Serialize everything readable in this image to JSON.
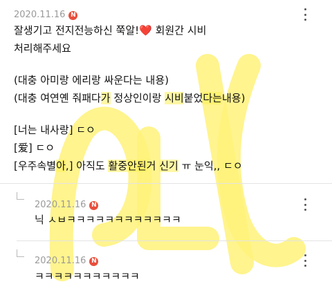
{
  "post": {
    "date": "2020.11.16",
    "badge": "N",
    "lines": [
      "잘생기고 전지전능하신 쭉알!",
      "❤️",
      " 회원간 시비",
      "처리해주세요",
      "(대충 아미랑 에리랑 싸운다는 내용)",
      "(대충 여연옌 줘패다",
      "가",
      " 정",
      "상인이랑 ",
      "시비",
      "붙었",
      "다는",
      "내용)",
      "[너는 내사랑] ㄷㅇ",
      "[爱] ㄷㅇ",
      "[우주속별",
      "아",
      ",] 아직도 ",
      "활중",
      "안된",
      "거 ",
      "신기",
      " ㅠ 눈익,, ㄷㅇ"
    ]
  },
  "comments": [
    {
      "date": "2020.11.16",
      "badge": "N",
      "text": "닉 ㅅㅂㅋㅋㅋㅋㅋㅋㅋㅋㅋㅋㅋㅋ"
    },
    {
      "date": "2020.11.16",
      "badge": "N",
      "text": "ㅋㅋㅋㅋㅋㅋㅋㅋㅋㅋㅋ"
    }
  ],
  "watermark": {
    "color": "#fff27a",
    "glyph_name": "watermark-scribble"
  },
  "colors": {
    "date": "#9a9a9a",
    "badge": "#e94e3c",
    "heart": "#d82b2b",
    "highlight": "#fff05a"
  },
  "icons": {
    "more": "kebab-icon",
    "reply": "reply-arrow-icon"
  }
}
